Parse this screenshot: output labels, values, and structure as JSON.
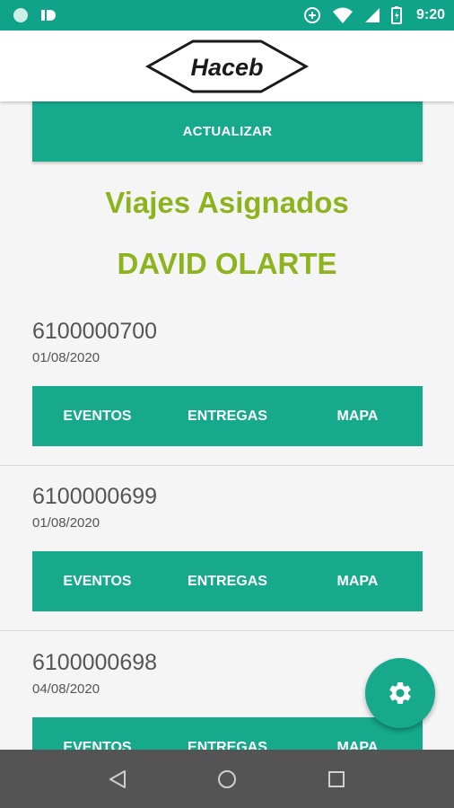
{
  "status_bar": {
    "time": "9:20"
  },
  "app_bar": {
    "logo_text": "Haceb"
  },
  "update_button_label": "ACTUALIZAR",
  "page_title": "Viajes Asignados",
  "driver_name": "DAVID OLARTE",
  "trips": [
    {
      "id": "6100000700",
      "date": "01/08/2020",
      "actions": [
        "EVENTOS",
        "ENTREGAS",
        "MAPA"
      ]
    },
    {
      "id": "6100000699",
      "date": "01/08/2020",
      "actions": [
        "EVENTOS",
        "ENTREGAS",
        "MAPA"
      ]
    },
    {
      "id": "6100000698",
      "date": "04/08/2020",
      "actions": [
        "EVENTOS",
        "ENTREGAS",
        "MAPA"
      ]
    }
  ],
  "fab_icon": "gear-icon",
  "nav_icons": [
    "back-icon",
    "home-icon",
    "recents-icon"
  ],
  "colors": {
    "accent": "#16a98c",
    "status_bar": "#0fa38a",
    "title": "#8db31f",
    "nav_bar": "#545454"
  }
}
